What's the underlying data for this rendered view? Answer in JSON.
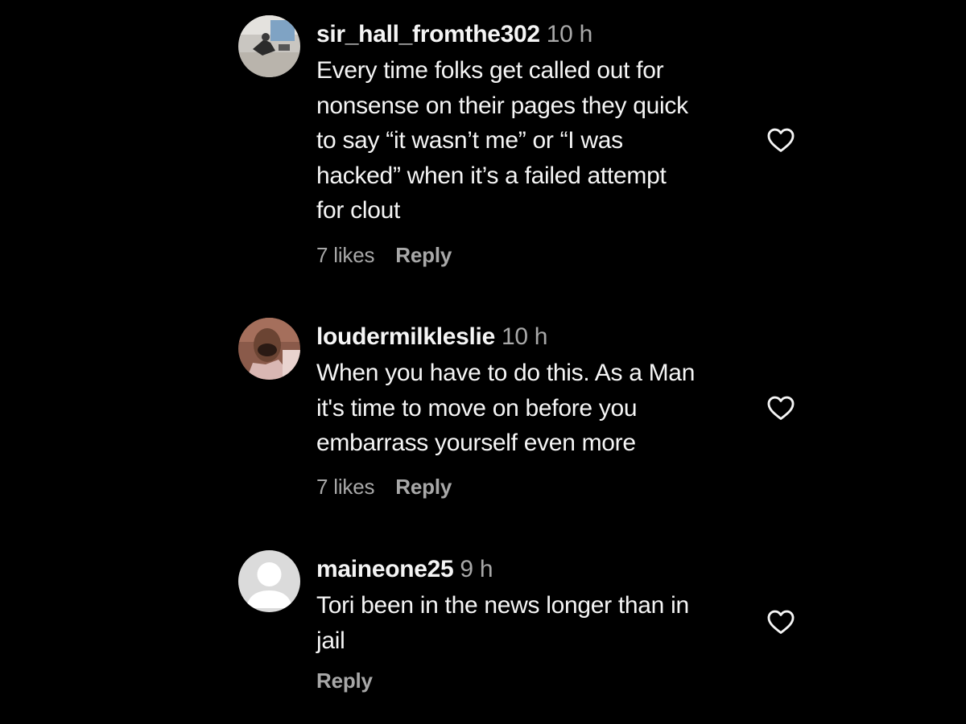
{
  "comments": [
    {
      "username": "sir_hall_fromthe302",
      "time": "10 h",
      "text": "Every time folks get called out for\nnonsense on their pages they quick\nto say “it wasn’t me” or “I was\nhacked” when it’s a failed attempt\nfor clout",
      "likes": "7 likes",
      "reply": "Reply",
      "avatar_icon": "photo-avatar"
    },
    {
      "username": "loudermilkleslie",
      "time": "10 h",
      "text": "When you have to do this. As a Man\nit's time to move on before you\nembarrass yourself even more",
      "likes": "7 likes",
      "reply": "Reply",
      "avatar_icon": "photo-avatar"
    },
    {
      "username": "maineone25",
      "time": "9 h",
      "text": "Tori been in the news longer than in\njail",
      "likes": "",
      "reply": "Reply",
      "avatar_icon": "default-avatar"
    }
  ],
  "icons": {
    "like": "heart-outline-icon"
  },
  "colors": {
    "background": "#000000",
    "primary_text": "#f5f5f5",
    "secondary_text": "#a8a8a8",
    "default_avatar_bg": "#dbdbdb"
  }
}
